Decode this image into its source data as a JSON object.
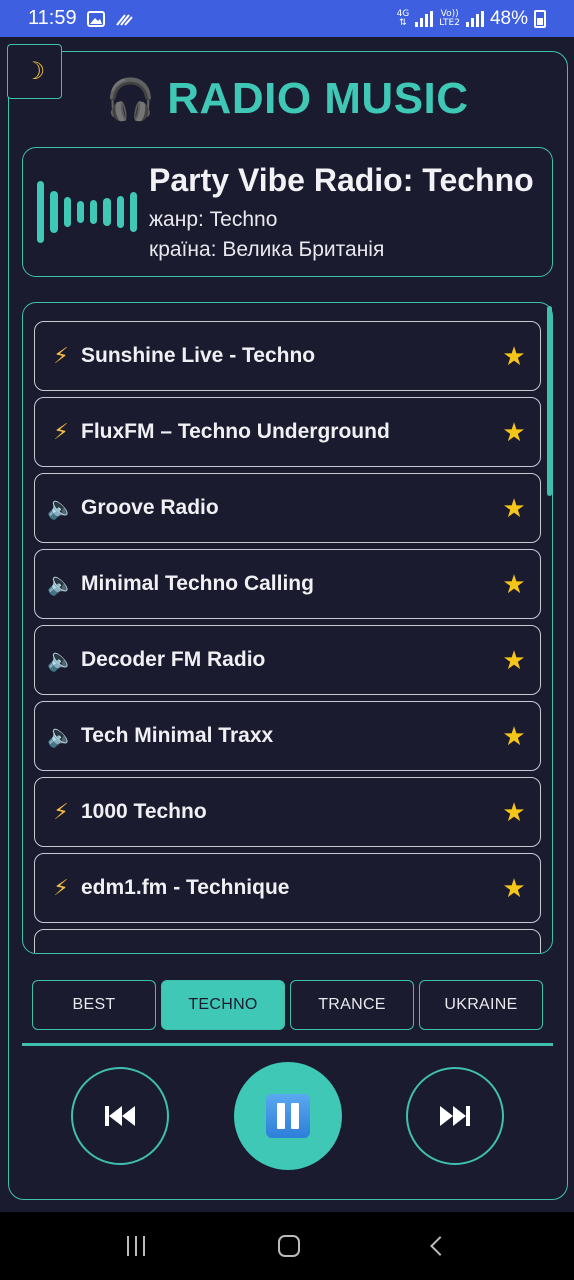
{
  "status_bar": {
    "time": "11:59",
    "network_top": "4G",
    "network_volte_top": "Vo))",
    "network_volte_bottom": "LTE2",
    "battery": "48%"
  },
  "header": {
    "theme_icon": "moon-icon",
    "headphones_icon": "headphones-icon",
    "title": "RADIO MUSIC"
  },
  "now_playing": {
    "station": "Party Vibe Radio: Techno",
    "genre_line": "жанр: Techno",
    "country_line": "країна: Велика Британія"
  },
  "stations": [
    {
      "label": "Sunshine Live - Techno",
      "icon": "bolt-icon"
    },
    {
      "label": "FluxFM – Techno Underground",
      "icon": "bolt-icon"
    },
    {
      "label": "Groove Radio",
      "icon": "speaker-icon"
    },
    {
      "label": "Minimal Techno Calling",
      "icon": "speaker-icon"
    },
    {
      "label": "Decoder FM Radio",
      "icon": "speaker-icon"
    },
    {
      "label": "Tech Minimal Traxx",
      "icon": "speaker-icon"
    },
    {
      "label": "1000 Techno",
      "icon": "bolt-icon"
    },
    {
      "label": "edm1.fm - Technique",
      "icon": "bolt-icon"
    }
  ],
  "tabs": [
    {
      "label": "BEST",
      "active": false
    },
    {
      "label": "TECHNO",
      "active": true
    },
    {
      "label": "TRANCE",
      "active": false
    },
    {
      "label": "UKRAINE",
      "active": false
    }
  ],
  "controls": {
    "prev_glyph": "⏮",
    "next_glyph": "⏭"
  },
  "colors": {
    "accent": "#3fc8b6",
    "background": "#1a1b2e",
    "star": "#f5c518",
    "status_bar": "#3d5fe0"
  }
}
